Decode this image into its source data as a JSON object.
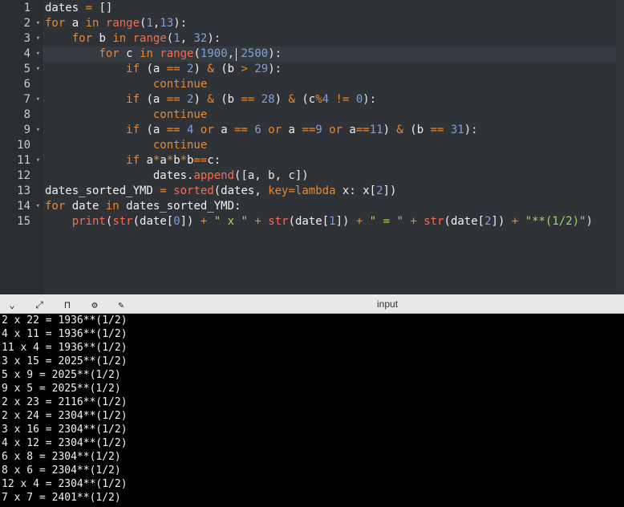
{
  "editor": {
    "line_numbers": [
      "1",
      "2",
      "3",
      "4",
      "5",
      "6",
      "7",
      "8",
      "9",
      "10",
      "11",
      "12",
      "13",
      "14",
      "15"
    ],
    "lines": [
      [
        [
          "tk-var",
          "dates "
        ],
        [
          "tk-op",
          "="
        ],
        [
          "tk-punct",
          " []"
        ]
      ],
      [
        [
          "tk-kw",
          "for"
        ],
        [
          "tk-var",
          " a "
        ],
        [
          "tk-kw",
          "in"
        ],
        [
          "tk-var",
          " "
        ],
        [
          "tk-fn",
          "range"
        ],
        [
          "tk-punct",
          "("
        ],
        [
          "tk-num",
          "1"
        ],
        [
          "tk-punct",
          ","
        ],
        [
          "tk-num",
          "13"
        ],
        [
          "tk-punct",
          "):"
        ]
      ],
      [
        [
          "tk-var",
          "    "
        ],
        [
          "tk-kw",
          "for"
        ],
        [
          "tk-var",
          " b "
        ],
        [
          "tk-kw",
          "in"
        ],
        [
          "tk-var",
          " "
        ],
        [
          "tk-fn",
          "range"
        ],
        [
          "tk-punct",
          "("
        ],
        [
          "tk-num",
          "1"
        ],
        [
          "tk-punct",
          ", "
        ],
        [
          "tk-num",
          "32"
        ],
        [
          "tk-punct",
          "):"
        ]
      ],
      [
        [
          "tk-var",
          "        "
        ],
        [
          "tk-kw",
          "for"
        ],
        [
          "tk-var",
          " c "
        ],
        [
          "tk-kw",
          "in"
        ],
        [
          "tk-var",
          " "
        ],
        [
          "tk-fn",
          "range"
        ],
        [
          "tk-punct",
          "("
        ],
        [
          "tk-num",
          "1900"
        ],
        [
          "tk-punct",
          ", "
        ],
        [
          "tk-num",
          "2500"
        ],
        [
          "tk-punct",
          "):"
        ]
      ],
      [
        [
          "tk-var",
          "            "
        ],
        [
          "tk-kw",
          "if"
        ],
        [
          "tk-var",
          " (a "
        ],
        [
          "tk-op",
          "=="
        ],
        [
          "tk-var",
          " "
        ],
        [
          "tk-num",
          "2"
        ],
        [
          "tk-var",
          ") "
        ],
        [
          "tk-op",
          "&"
        ],
        [
          "tk-var",
          " (b "
        ],
        [
          "tk-op",
          ">"
        ],
        [
          "tk-var",
          " "
        ],
        [
          "tk-num",
          "29"
        ],
        [
          "tk-punct",
          "):"
        ]
      ],
      [
        [
          "tk-var",
          "                "
        ],
        [
          "tk-kw",
          "continue"
        ]
      ],
      [
        [
          "tk-var",
          "            "
        ],
        [
          "tk-kw",
          "if"
        ],
        [
          "tk-var",
          " (a "
        ],
        [
          "tk-op",
          "=="
        ],
        [
          "tk-var",
          " "
        ],
        [
          "tk-num",
          "2"
        ],
        [
          "tk-var",
          ") "
        ],
        [
          "tk-op",
          "&"
        ],
        [
          "tk-var",
          " (b "
        ],
        [
          "tk-op",
          "=="
        ],
        [
          "tk-var",
          " "
        ],
        [
          "tk-num",
          "28"
        ],
        [
          "tk-var",
          ") "
        ],
        [
          "tk-op",
          "&"
        ],
        [
          "tk-var",
          " (c"
        ],
        [
          "tk-op",
          "%"
        ],
        [
          "tk-num",
          "4"
        ],
        [
          "tk-var",
          " "
        ],
        [
          "tk-op",
          "!="
        ],
        [
          "tk-var",
          " "
        ],
        [
          "tk-num",
          "0"
        ],
        [
          "tk-punct",
          "):"
        ]
      ],
      [
        [
          "tk-var",
          "                "
        ],
        [
          "tk-kw",
          "continue"
        ]
      ],
      [
        [
          "tk-var",
          "            "
        ],
        [
          "tk-kw",
          "if"
        ],
        [
          "tk-var",
          " (a "
        ],
        [
          "tk-op",
          "=="
        ],
        [
          "tk-var",
          " "
        ],
        [
          "tk-num",
          "4"
        ],
        [
          "tk-var",
          " "
        ],
        [
          "tk-kw",
          "or"
        ],
        [
          "tk-var",
          " a "
        ],
        [
          "tk-op",
          "=="
        ],
        [
          "tk-var",
          " "
        ],
        [
          "tk-num",
          "6"
        ],
        [
          "tk-var",
          " "
        ],
        [
          "tk-kw",
          "or"
        ],
        [
          "tk-var",
          " a "
        ],
        [
          "tk-op",
          "=="
        ],
        [
          "tk-num",
          "9"
        ],
        [
          "tk-var",
          " "
        ],
        [
          "tk-kw",
          "or"
        ],
        [
          "tk-var",
          " a"
        ],
        [
          "tk-op",
          "=="
        ],
        [
          "tk-num",
          "11"
        ],
        [
          "tk-var",
          ") "
        ],
        [
          "tk-op",
          "&"
        ],
        [
          "tk-var",
          " (b "
        ],
        [
          "tk-op",
          "=="
        ],
        [
          "tk-var",
          " "
        ],
        [
          "tk-num",
          "31"
        ],
        [
          "tk-punct",
          "):"
        ]
      ],
      [
        [
          "tk-var",
          "                "
        ],
        [
          "tk-kw",
          "continue"
        ]
      ],
      [
        [
          "tk-var",
          "            "
        ],
        [
          "tk-kw",
          "if"
        ],
        [
          "tk-var",
          " a"
        ],
        [
          "tk-op",
          "*"
        ],
        [
          "tk-var",
          "a"
        ],
        [
          "tk-op",
          "*"
        ],
        [
          "tk-var",
          "b"
        ],
        [
          "tk-op",
          "*"
        ],
        [
          "tk-var",
          "b"
        ],
        [
          "tk-op",
          "=="
        ],
        [
          "tk-var",
          "c:"
        ]
      ],
      [
        [
          "tk-var",
          "                dates."
        ],
        [
          "tk-fn",
          "append"
        ],
        [
          "tk-punct",
          "([a, b, c])"
        ]
      ],
      [
        [
          "tk-var",
          "dates_sorted_YMD "
        ],
        [
          "tk-op",
          "="
        ],
        [
          "tk-var",
          " "
        ],
        [
          "tk-fn",
          "sorted"
        ],
        [
          "tk-var",
          "(dates, "
        ],
        [
          "tk-op",
          "key"
        ],
        [
          "tk-op",
          "="
        ],
        [
          "tk-kw",
          "lambda"
        ],
        [
          "tk-var",
          " x: x["
        ],
        [
          "tk-num",
          "2"
        ],
        [
          "tk-var",
          "])"
        ]
      ],
      [
        [
          "tk-kw",
          "for"
        ],
        [
          "tk-var",
          " date "
        ],
        [
          "tk-kw",
          "in"
        ],
        [
          "tk-var",
          " dates_sorted_YMD:"
        ]
      ],
      [
        [
          "tk-var",
          "    "
        ],
        [
          "tk-fn",
          "print"
        ],
        [
          "tk-punct",
          "("
        ],
        [
          "tk-fn",
          "str"
        ],
        [
          "tk-var",
          "(date["
        ],
        [
          "tk-num",
          "0"
        ],
        [
          "tk-var",
          "]) "
        ],
        [
          "tk-op",
          "+"
        ],
        [
          "tk-var",
          " "
        ],
        [
          "tk-str",
          "\" x \""
        ],
        [
          "tk-var",
          " "
        ],
        [
          "tk-op",
          "+"
        ],
        [
          "tk-var",
          " "
        ],
        [
          "tk-fn",
          "str"
        ],
        [
          "tk-var",
          "(date["
        ],
        [
          "tk-num",
          "1"
        ],
        [
          "tk-var",
          "]) "
        ],
        [
          "tk-op",
          "+"
        ],
        [
          "tk-var",
          " "
        ],
        [
          "tk-str",
          "\" = \""
        ],
        [
          "tk-var",
          " "
        ],
        [
          "tk-op",
          "+"
        ],
        [
          "tk-var",
          " "
        ],
        [
          "tk-fn",
          "str"
        ],
        [
          "tk-var",
          "(date["
        ],
        [
          "tk-num",
          "2"
        ],
        [
          "tk-var",
          "]) "
        ],
        [
          "tk-op",
          "+"
        ],
        [
          "tk-var",
          " "
        ],
        [
          "tk-str",
          "\"**(1/2)\""
        ],
        [
          "tk-punct",
          ")"
        ]
      ]
    ]
  },
  "toolbar": {
    "icons": [
      "chevron-down-icon",
      "expand-icon",
      "pin-icon",
      "gear-icon",
      "debug-icon"
    ],
    "glyphs": [
      "⌄",
      "⤢",
      "⊓",
      "⚙",
      "✎"
    ],
    "panel_title": "input"
  },
  "console": {
    "lines": [
      "2 x 22 = 1936**(1/2)",
      "4 x 11 = 1936**(1/2)",
      "11 x 4 = 1936**(1/2)",
      "3 x 15 = 2025**(1/2)",
      "5 x 9 = 2025**(1/2)",
      "9 x 5 = 2025**(1/2)",
      "2 x 23 = 2116**(1/2)",
      "2 x 24 = 2304**(1/2)",
      "3 x 16 = 2304**(1/2)",
      "4 x 12 = 2304**(1/2)",
      "6 x 8 = 2304**(1/2)",
      "8 x 6 = 2304**(1/2)",
      "12 x 4 = 2304**(1/2)",
      "7 x 7 = 2401**(1/2)"
    ]
  }
}
